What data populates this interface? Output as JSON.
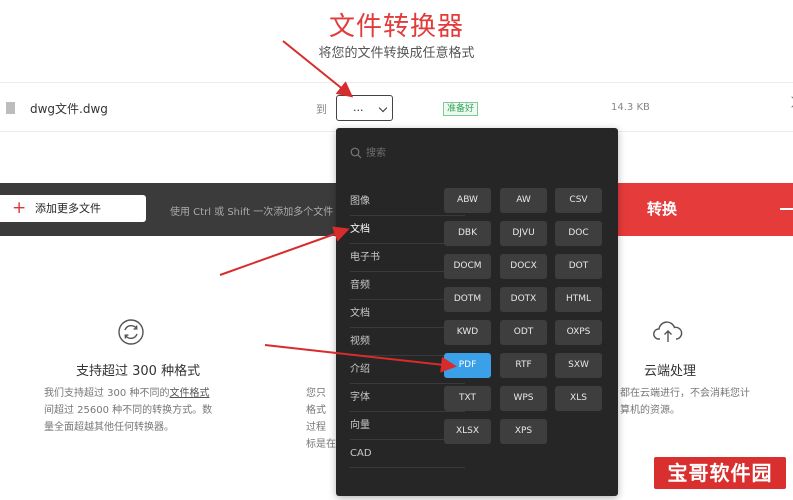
{
  "header": {
    "title": "文件转换器",
    "subtitle": "将您的文件转换成任意格式"
  },
  "file_row": {
    "file_name": "dwg文件.dwg",
    "to_label": "到",
    "format_value": "...",
    "status": "准备好",
    "file_size": "14.3 KB",
    "icons": {
      "file": "file-icon",
      "more": "chevron-right-icon"
    }
  },
  "action_bar": {
    "add_files": "添加更多文件",
    "hint": "使用 Ctrl 或 Shift 一次添加多个文件",
    "convert": "转换",
    "icons": {
      "add": "plus-icon",
      "convert_more": "dash-icon"
    }
  },
  "features": [
    {
      "icon": "refresh-icon",
      "title": "支持超过 300 种格式",
      "lines": [
        [
          "我们支持超过 300 种不同的",
          "文件格式"
        ],
        [
          "间超过 25600 种不同的转换方式。数"
        ],
        [
          "量全面超越其他任何转换器。"
        ]
      ]
    },
    {
      "lines": [
        [
          "您只"
        ],
        [
          "格式"
        ],
        [
          "过程"
        ],
        [
          "标是在"
        ]
      ]
    },
    {
      "icon": "cloud-upload-icon",
      "title": "云端处理",
      "lines": [
        [
          "都在云端进行，不会消耗您计"
        ],
        [
          "算机的资源。"
        ]
      ]
    }
  ],
  "dropdown": {
    "search_placeholder": "搜索",
    "categories": [
      "图像",
      "文档",
      "电子书",
      "音频",
      "文档",
      "视频",
      "介绍",
      "字体",
      "向量",
      "CAD"
    ],
    "active_category": 1,
    "formats": [
      "ABW",
      "AW",
      "CSV",
      "DBK",
      "DJVU",
      "DOC",
      "DOCM",
      "DOCX",
      "DOT",
      "DOTM",
      "DOTX",
      "HTML",
      "KWD",
      "ODT",
      "OXPS",
      "PDF",
      "RTF",
      "SXW",
      "TXT",
      "WPS",
      "XLS",
      "XLSX",
      "XPS"
    ],
    "selected_format": "PDF"
  },
  "watermark": "宝哥软件园",
  "colors": {
    "accent_red": "#e63b3b",
    "dark_bar": "#3b3b3b",
    "dropdown_bg": "#262626",
    "selected_blue": "#3aa0e8",
    "ready_green": "#3aa15b"
  }
}
